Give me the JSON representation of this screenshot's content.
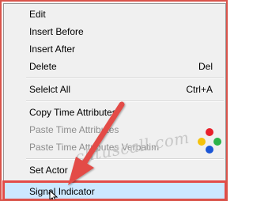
{
  "menu": {
    "items": [
      {
        "label": "Edit",
        "shortcut": "",
        "disabled": false
      },
      {
        "label": "Insert Before",
        "shortcut": "",
        "disabled": false
      },
      {
        "label": "Insert After",
        "shortcut": "",
        "disabled": false
      },
      {
        "label": "Delete",
        "shortcut": "Del",
        "disabled": false
      },
      {
        "label": "Selelct All",
        "shortcut": "Ctrl+A",
        "disabled": false
      },
      {
        "label": "Copy Time Attributes",
        "shortcut": "",
        "disabled": false
      },
      {
        "label": "Paste Time Attributes",
        "shortcut": "",
        "disabled": true
      },
      {
        "label": "Paste Time Attributes Verbatim",
        "shortcut": "",
        "disabled": true
      },
      {
        "label": "Set Actor",
        "shortcut": "",
        "disabled": false
      },
      {
        "label": "Signal Indicator",
        "shortcut": "",
        "disabled": false,
        "highlighted": true
      }
    ]
  },
  "watermark": {
    "text": "chtuscall.com"
  },
  "colors": {
    "highlight_bg": "#cce8ff",
    "annotation_red": "#e34b47",
    "dot_red": "#e8202a",
    "dot_green": "#2bb34a",
    "dot_blue": "#1a55d6",
    "dot_yellow": "#f4c20d"
  },
  "icons": {
    "annotation_arrow": "arrow-annotation-icon",
    "mouse_cursor": "mouse-cursor-icon",
    "brand_dots": "colored-dots-icon"
  }
}
